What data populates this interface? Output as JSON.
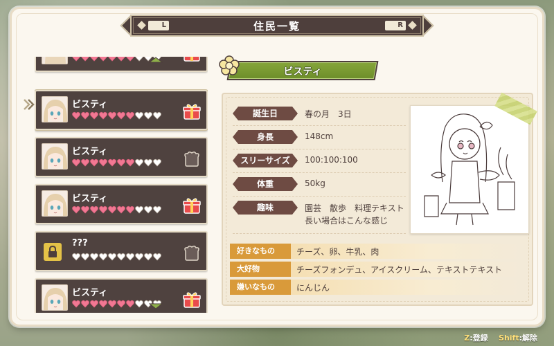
{
  "header": {
    "title": "住民一覧",
    "left_key": "L",
    "right_key": "R"
  },
  "list": {
    "partial_top": {
      "hearts_filled": 7,
      "hearts_total": 10,
      "gift": "gift-icon"
    },
    "cards": [
      {
        "name": "ビスティ",
        "hearts_filled": 7,
        "hearts_total": 10,
        "gift": "gift-icon",
        "locked": false,
        "selected": true
      },
      {
        "name": "ビスティ",
        "hearts_filled": 7,
        "hearts_total": 10,
        "gift": "gift-empty-icon",
        "locked": false,
        "selected": false
      },
      {
        "name": "ビスティ",
        "hearts_filled": 7,
        "hearts_total": 10,
        "gift": "gift-icon",
        "locked": false,
        "selected": false
      },
      {
        "name": "???",
        "hearts_filled": 0,
        "hearts_total": 10,
        "gift": "gift-empty-icon",
        "locked": true,
        "selected": false
      },
      {
        "name": "ビスティ",
        "hearts_filled": 7,
        "hearts_total": 10,
        "gift": "gift-icon",
        "locked": false,
        "selected": false
      }
    ]
  },
  "detail": {
    "name": "ビスティ",
    "stats": [
      {
        "label": "誕生日",
        "value": "春の月　3日"
      },
      {
        "label": "身長",
        "value": "148cm"
      },
      {
        "label": "スリーサイズ",
        "value": "100:100:100"
      },
      {
        "label": "体重",
        "value": "50kg"
      },
      {
        "label": "趣味",
        "value": "園芸　散歩　料理テキスト",
        "value2": "長い場合はこんな感じ"
      }
    ],
    "prefs": [
      {
        "label": "好きなもの",
        "value": "チーズ、卵、牛乳、肉"
      },
      {
        "label": "大好物",
        "value": "チーズフォンデュ、アイスクリーム、テキストテキスト"
      },
      {
        "label": "嫌いなもの",
        "value": "にんじん"
      }
    ]
  },
  "footer": {
    "register_key": "Z",
    "register_label": ":登録",
    "release_key": "Shift",
    "release_label": ":解除"
  },
  "colors": {
    "panel": "#fbf7ef",
    "card": "#4f423f",
    "heart_filled": "#f27893",
    "heart_empty": "#ffffff",
    "banner_green": "#7a9a30",
    "stat_label": "#6e4b43",
    "pref_label": "#d99a3a"
  }
}
